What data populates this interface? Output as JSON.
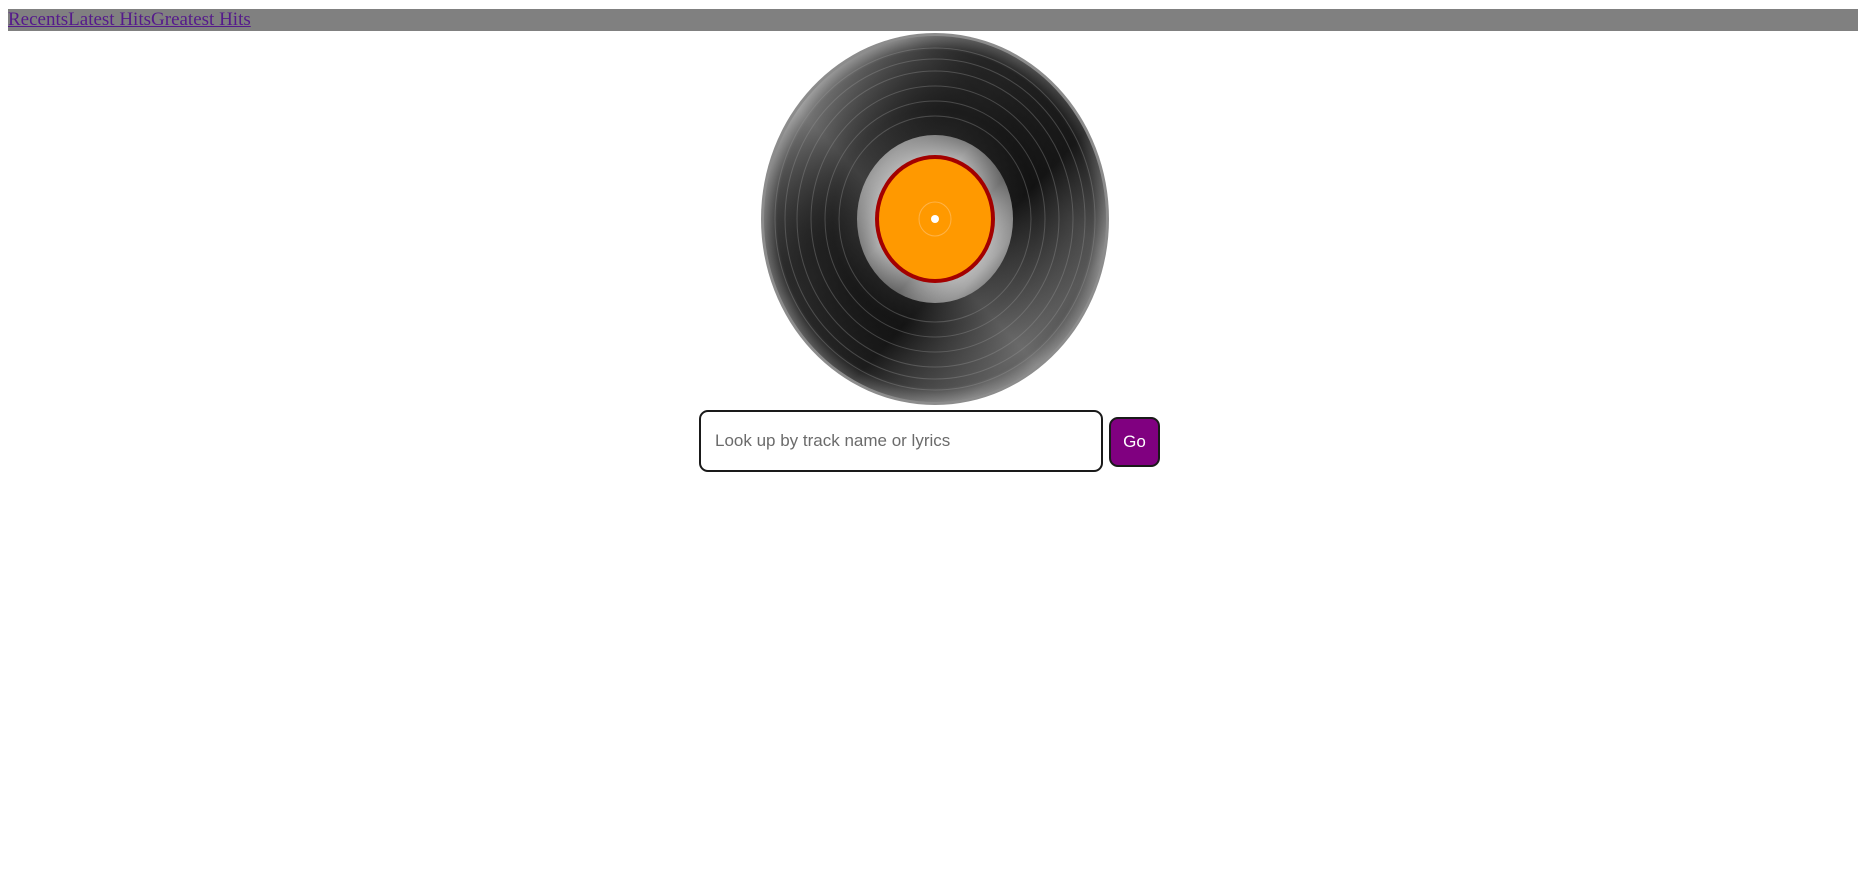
{
  "nav": {
    "links": [
      {
        "label": "Recents"
      },
      {
        "label": "Latest Hits"
      },
      {
        "label": "Greatest Hits"
      }
    ]
  },
  "record": {
    "icon": "vinyl-record-icon",
    "label_color": "#ff9900",
    "label_ring_color": "#a30000",
    "disc_color": "#1a1a1a"
  },
  "search": {
    "value": "",
    "placeholder": "Look up by track name or lyrics",
    "go_label": "Go",
    "go_color": "#800080"
  }
}
